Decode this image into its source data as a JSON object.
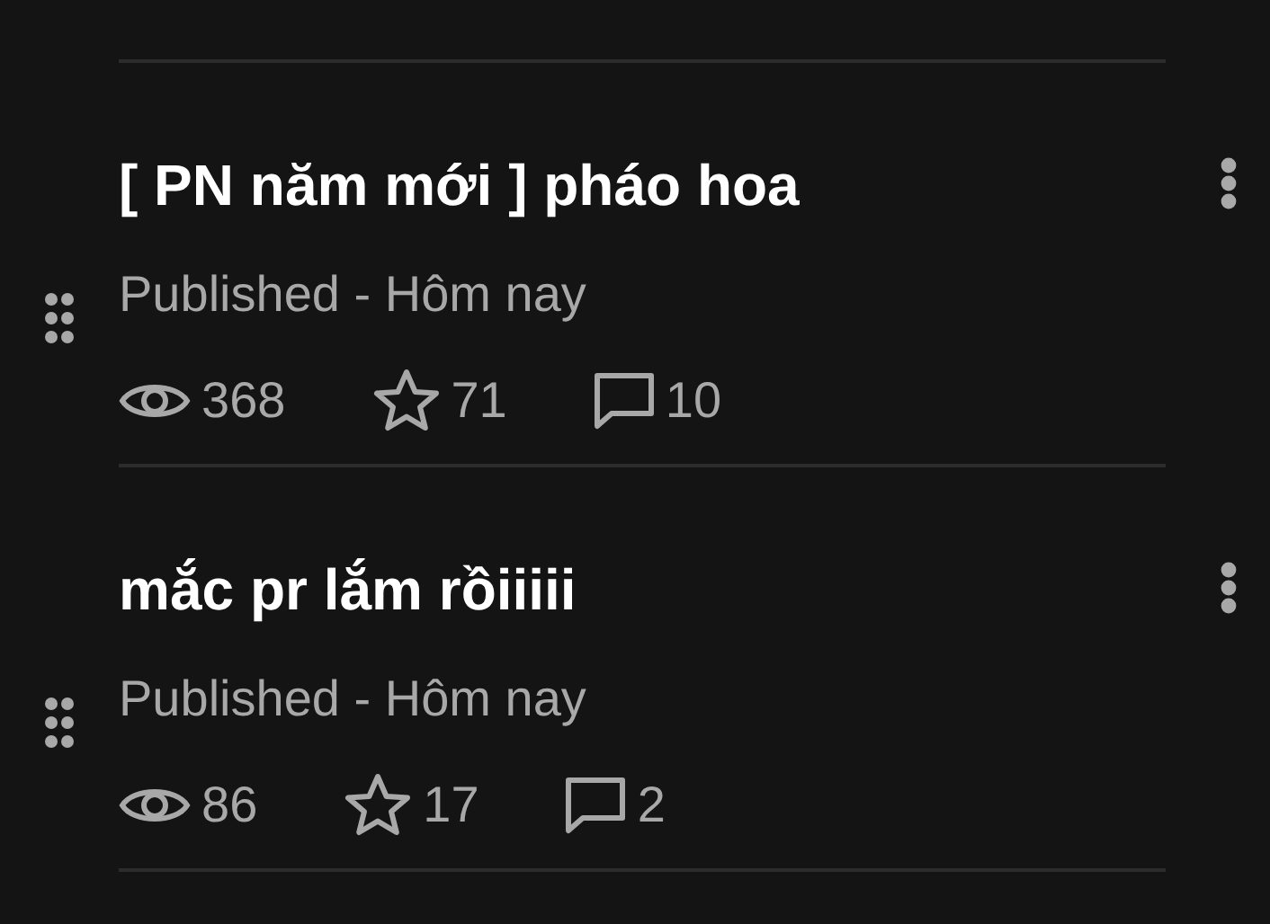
{
  "posts": [
    {
      "title": "[ PN năm mới ] pháo hoa",
      "meta": "Published - Hôm nay",
      "views": "368",
      "favorites": "71",
      "comments": "10"
    },
    {
      "title": "mắc pr lắm rồiiiii",
      "meta": "Published - Hôm nay",
      "views": "86",
      "favorites": "17",
      "comments": "2"
    }
  ]
}
